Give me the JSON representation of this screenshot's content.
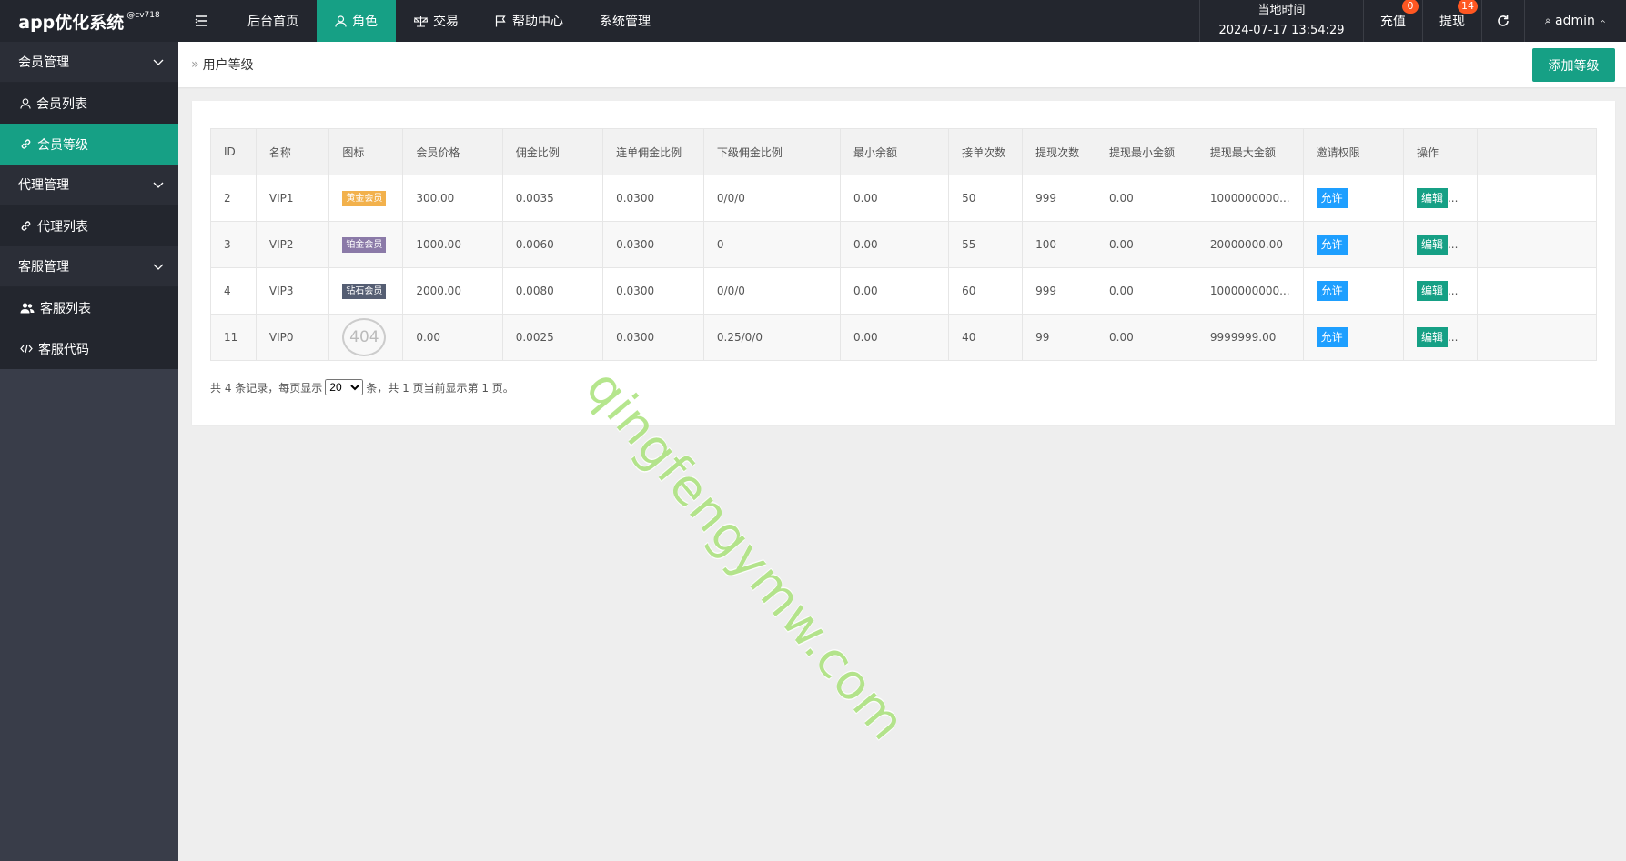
{
  "app": {
    "title": "app优化系统",
    "version": "@cv718"
  },
  "topnav": {
    "items": [
      {
        "label": "后台首页",
        "icon": ""
      },
      {
        "label": "角色",
        "icon": "user-icon"
      },
      {
        "label": "交易",
        "icon": "scale-icon"
      },
      {
        "label": "帮助中心",
        "icon": "flag-icon"
      },
      {
        "label": "系统管理",
        "icon": ""
      }
    ],
    "active_index": 1
  },
  "header": {
    "time_label": "当地时间",
    "time_value": "2024-07-17 13:54:29",
    "recharge": {
      "label": "充值",
      "badge": "0"
    },
    "withdraw": {
      "label": "提现",
      "badge": "14"
    },
    "user": "admin"
  },
  "sidebar": {
    "groups": [
      {
        "label": "会员管理",
        "items": [
          {
            "label": "会员列表",
            "icon": "user-icon"
          },
          {
            "label": "会员等级",
            "icon": "link-icon",
            "active": true
          }
        ]
      },
      {
        "label": "代理管理",
        "items": [
          {
            "label": "代理列表",
            "icon": "link-icon"
          }
        ]
      },
      {
        "label": "客服管理",
        "items": [
          {
            "label": "客服列表",
            "icon": "users-icon"
          },
          {
            "label": "客服代码",
            "icon": "code-icon"
          }
        ]
      }
    ]
  },
  "breadcrumb": {
    "current": "用户等级"
  },
  "add_button": "添加等级",
  "table": {
    "headers": [
      "ID",
      "名称",
      "图标",
      "会员价格",
      "佣金比例",
      "连单佣金比例",
      "下级佣金比例",
      "最小余额",
      "接单次数",
      "提现次数",
      "提现最小金额",
      "提现最大金额",
      "邀请权限",
      "操作"
    ],
    "rows": [
      {
        "id": "2",
        "name": "VIP1",
        "icon_label": "黄金会员",
        "icon_type": "gold",
        "price": "300.00",
        "commission": "0.0035",
        "chain_commission": "0.0300",
        "sub_commission": "0/0/0",
        "min_balance": "0.00",
        "orders": "50",
        "withdraw_times": "999",
        "withdraw_min": "0.00",
        "withdraw_max": "1000000000...",
        "invite": "允许",
        "edit": "编辑"
      },
      {
        "id": "3",
        "name": "VIP2",
        "icon_label": "铂金会员",
        "icon_type": "plat",
        "price": "1000.00",
        "commission": "0.0060",
        "chain_commission": "0.0300",
        "sub_commission": "0",
        "min_balance": "0.00",
        "orders": "55",
        "withdraw_times": "100",
        "withdraw_min": "0.00",
        "withdraw_max": "20000000.00",
        "invite": "允许",
        "edit": "编辑"
      },
      {
        "id": "4",
        "name": "VIP3",
        "icon_label": "钻石会员",
        "icon_type": "diam",
        "price": "2000.00",
        "commission": "0.0080",
        "chain_commission": "0.0300",
        "sub_commission": "0/0/0",
        "min_balance": "0.00",
        "orders": "60",
        "withdraw_times": "999",
        "withdraw_min": "0.00",
        "withdraw_max": "1000000000...",
        "invite": "允许",
        "edit": "编辑"
      },
      {
        "id": "11",
        "name": "VIP0",
        "icon_label": "404",
        "icon_type": "missing",
        "price": "0.00",
        "commission": "0.0025",
        "chain_commission": "0.0300",
        "sub_commission": "0.25/0/0",
        "min_balance": "0.00",
        "orders": "40",
        "withdraw_times": "99",
        "withdraw_min": "0.00",
        "withdraw_max": "9999999.00",
        "invite": "允许",
        "edit": "编辑"
      }
    ]
  },
  "pager": {
    "prefix": "共 4 条记录，每页显示",
    "page_size": "20",
    "suffix": "条，共 1 页当前显示第 1 页。"
  },
  "watermark": "qingfengymw.com",
  "colors": {
    "accent": "#16a085",
    "header_bg": "#23262e",
    "sidebar_bg": "#393d49",
    "allow_blue": "#1e9fff",
    "badge": "#ff5722"
  }
}
